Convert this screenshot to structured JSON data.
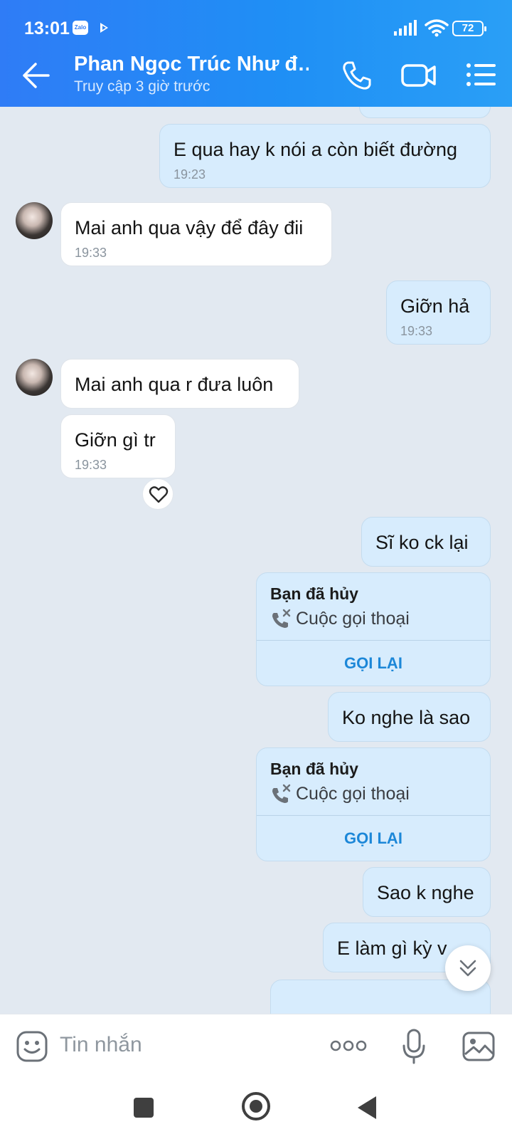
{
  "status_bar": {
    "time": "13:01",
    "app_badge": "Zalo",
    "battery": "72"
  },
  "header": {
    "title": "Phan Ngọc Trúc Như đ…",
    "subtitle": "Truy cập 3 giờ trước"
  },
  "messages": [
    {
      "from": "me",
      "text": "E qua hay k nói a còn biết đường",
      "time": "19:23"
    },
    {
      "from": "them",
      "text": "Mai anh qua vậy để đây đii",
      "time": "19:33"
    },
    {
      "from": "me",
      "text": "Giỡn hả",
      "time": "19:33"
    },
    {
      "from": "them",
      "text": "Mai anh qua r đưa luôn"
    },
    {
      "from": "them",
      "text": "Giỡn gì tr",
      "time": "19:33"
    },
    {
      "from": "me",
      "text": "Sĩ ko ck lại"
    },
    {
      "from": "me",
      "type": "call",
      "title": "Bạn đã hủy",
      "subtitle": "Cuộc gọi thoại",
      "action": "GỌI LẠI"
    },
    {
      "from": "me",
      "text": "Ko nghe là sao"
    },
    {
      "from": "me",
      "type": "call",
      "title": "Bạn đã hủy",
      "subtitle": "Cuộc gọi thoại",
      "action": "GỌI LẠI"
    },
    {
      "from": "me",
      "text": "Sao k nghe"
    },
    {
      "from": "me",
      "text": "E làm gì kỳ v"
    }
  ],
  "input": {
    "placeholder": "Tin nhắn"
  },
  "colors": {
    "header_blue": "#2f7cf6",
    "my_bubble": "#d7ecfd",
    "their_bubble": "#ffffff",
    "action_blue": "#1c87d8",
    "chat_bg": "#e2e9f1"
  },
  "icons": [
    "back-icon",
    "call-icon",
    "video-icon",
    "menu-icon",
    "heart-icon",
    "chevron-down-icon",
    "sticker-icon",
    "more-icon",
    "mic-icon",
    "image-icon"
  ]
}
